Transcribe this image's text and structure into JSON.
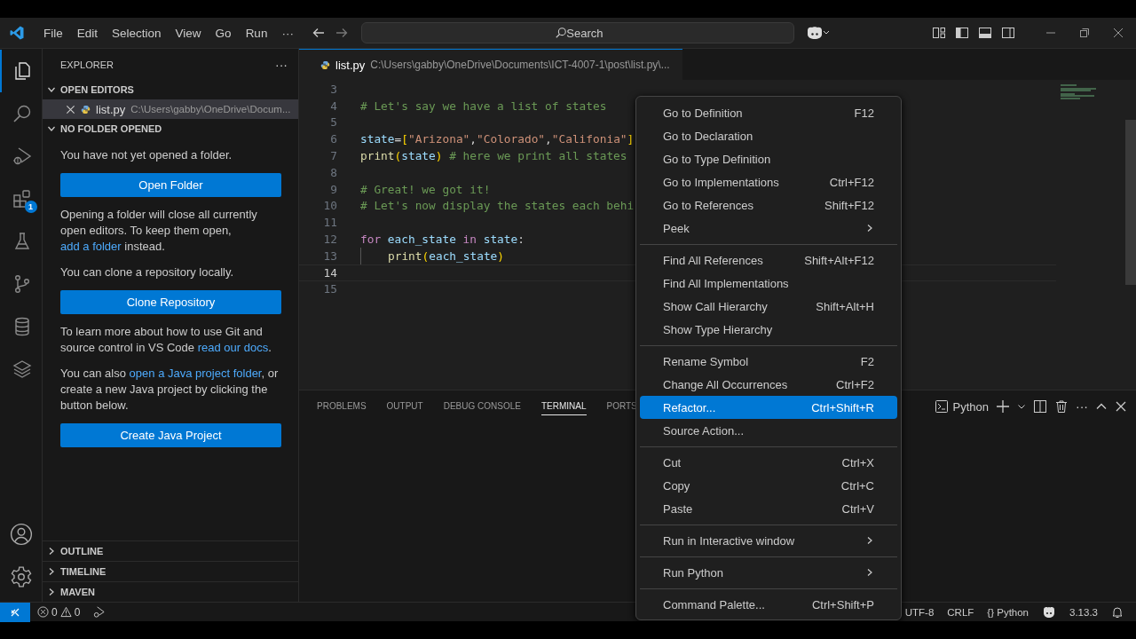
{
  "title_bar": {
    "menu": [
      "File",
      "Edit",
      "Selection",
      "View",
      "Go",
      "Run",
      "···"
    ],
    "search": {
      "placeholder": "Search"
    }
  },
  "activity_bar": {
    "items": [
      {
        "kind": "explorer",
        "selected": true
      },
      {
        "kind": "search",
        "selected": false
      },
      {
        "kind": "debug",
        "selected": false
      },
      {
        "kind": "extensions",
        "selected": false,
        "badge": "1"
      },
      {
        "kind": "testing",
        "selected": false
      },
      {
        "kind": "source-control",
        "selected": false
      },
      {
        "kind": "database",
        "selected": false
      },
      {
        "kind": "layers",
        "selected": false
      }
    ],
    "bottom": [
      {
        "kind": "account"
      },
      {
        "kind": "settings"
      }
    ]
  },
  "sidebar": {
    "title": "EXPLORER",
    "more": "···",
    "open_editors": {
      "title": "OPEN EDITORS",
      "expanded": true,
      "items": [
        {
          "name": "list.py",
          "path": "C:\\Users\\gabby\\OneDrive\\Docum...",
          "selected": true
        }
      ]
    },
    "folder": {
      "title": "NO FOLDER OPENED",
      "expanded": true,
      "blocks": [
        {
          "kind": "text",
          "parts": [
            {
              "text": "You have not yet opened a folder."
            }
          ]
        },
        {
          "kind": "button",
          "text": "Open Folder"
        },
        {
          "kind": "text",
          "parts": [
            {
              "text": "Opening a folder will close all currently open editors. To keep them open, "
            },
            {
              "text": "add a folder",
              "link": true
            },
            {
              "text": " instead."
            }
          ]
        },
        {
          "kind": "text",
          "parts": [
            {
              "text": "You can clone a repository locally."
            }
          ]
        },
        {
          "kind": "button",
          "text": "Clone Repository"
        },
        {
          "kind": "text",
          "parts": [
            {
              "text": "To learn more about how to use Git and source control in VS Code "
            },
            {
              "text": "read our docs",
              "link": true
            },
            {
              "text": "."
            }
          ]
        },
        {
          "kind": "text",
          "parts": [
            {
              "text": "You can also "
            },
            {
              "text": "open a Java project folder",
              "link": true
            },
            {
              "text": ", or create a new Java project by clicking the button below."
            }
          ]
        },
        {
          "kind": "button",
          "text": "Create Java Project"
        }
      ]
    },
    "sections": [
      {
        "title": "OUTLINE",
        "expanded": false
      },
      {
        "title": "TIMELINE",
        "expanded": false
      },
      {
        "title": "MAVEN",
        "expanded": false
      }
    ]
  },
  "editor": {
    "tab": {
      "name": "list.py",
      "path": "C:\\Users\\gabby\\OneDrive\\Documents\\ICT-4007-1\\post\\list.py\\..."
    },
    "lines": [
      {
        "number": "3",
        "current": false,
        "indent": false
      },
      {
        "number": "4",
        "current": false,
        "indent": false,
        "tokens": [
          {
            "text": "# Let's say we have a list of states",
            "kind": "comment"
          }
        ]
      },
      {
        "number": "5",
        "current": false,
        "indent": false
      },
      {
        "number": "6",
        "current": false,
        "indent": false,
        "tokens": [
          {
            "text": "state",
            "kind": "variable"
          },
          {
            "text": "=",
            "kind": "operator"
          },
          {
            "text": "[",
            "kind": "bracket"
          },
          {
            "text": "\"Arizona\"",
            "kind": "string"
          },
          {
            "text": ",",
            "kind": "operator"
          },
          {
            "text": "\"Colorado\"",
            "kind": "string"
          },
          {
            "text": ",",
            "kind": "operator"
          },
          {
            "text": "\"Califonia\"",
            "kind": "string"
          },
          {
            "text": "]",
            "kind": "bracket"
          }
        ]
      },
      {
        "number": "7",
        "current": false,
        "indent": false,
        "tokens": [
          {
            "text": "print",
            "kind": "function"
          },
          {
            "text": "(",
            "kind": "bracket"
          },
          {
            "text": "state",
            "kind": "variable"
          },
          {
            "text": ")",
            "kind": "bracket"
          },
          {
            "text": " # here we print all states",
            "kind": "comment"
          }
        ]
      },
      {
        "number": "8",
        "current": false,
        "indent": false
      },
      {
        "number": "9",
        "current": false,
        "indent": false,
        "tokens": [
          {
            "text": "# Great! we got it!",
            "kind": "comment"
          }
        ]
      },
      {
        "number": "10",
        "current": false,
        "indent": false,
        "tokens": [
          {
            "text": "# Let's now display the states each behi",
            "kind": "comment"
          }
        ]
      },
      {
        "number": "11",
        "current": false,
        "indent": false
      },
      {
        "number": "12",
        "current": false,
        "indent": false,
        "tokens": [
          {
            "text": "for",
            "kind": "keyword"
          },
          {
            "text": " each_state",
            "kind": "variable"
          },
          {
            "text": " in",
            "kind": "keyword"
          },
          {
            "text": " state",
            "kind": "variable"
          },
          {
            "text": ":",
            "kind": "operator"
          }
        ]
      },
      {
        "number": "13",
        "current": false,
        "indent": true,
        "tokens": [
          {
            "text": "print",
            "kind": "function"
          },
          {
            "text": "(",
            "kind": "bracket"
          },
          {
            "text": "each_state",
            "kind": "variable"
          },
          {
            "text": ")",
            "kind": "bracket"
          }
        ]
      },
      {
        "number": "14",
        "current": true,
        "indent": false
      },
      {
        "number": "15",
        "current": false,
        "indent": false
      }
    ]
  },
  "panel": {
    "tabs": [
      {
        "label": "PROBLEMS",
        "selected": false
      },
      {
        "label": "OUTPUT",
        "selected": false
      },
      {
        "label": "DEBUG CONSOLE",
        "selected": false
      },
      {
        "label": "TERMINAL",
        "selected": true
      },
      {
        "label": "PORTS",
        "selected": false
      }
    ],
    "terminal": "Python",
    "more": "···"
  },
  "context_menu": {
    "groups": [
      [
        {
          "label": "Go to Definition",
          "shortcut": "F12",
          "submenu": false,
          "selected": false
        },
        {
          "label": "Go to Declaration",
          "submenu": false,
          "selected": false
        },
        {
          "label": "Go to Type Definition",
          "submenu": false,
          "selected": false
        },
        {
          "label": "Go to Implementations",
          "shortcut": "Ctrl+F12",
          "submenu": false,
          "selected": false
        },
        {
          "label": "Go to References",
          "shortcut": "Shift+F12",
          "submenu": false,
          "selected": false
        },
        {
          "label": "Peek",
          "submenu": true,
          "selected": false
        }
      ],
      [
        {
          "label": "Find All References",
          "shortcut": "Shift+Alt+F12",
          "submenu": false,
          "selected": false
        },
        {
          "label": "Find All Implementations",
          "submenu": false,
          "selected": false
        },
        {
          "label": "Show Call Hierarchy",
          "shortcut": "Shift+Alt+H",
          "submenu": false,
          "selected": false
        },
        {
          "label": "Show Type Hierarchy",
          "submenu": false,
          "selected": false
        }
      ],
      [
        {
          "label": "Rename Symbol",
          "shortcut": "F2",
          "submenu": false,
          "selected": false
        },
        {
          "label": "Change All Occurrences",
          "shortcut": "Ctrl+F2",
          "submenu": false,
          "selected": false
        },
        {
          "label": "Refactor...",
          "shortcut": "Ctrl+Shift+R",
          "submenu": false,
          "selected": true
        },
        {
          "label": "Source Action...",
          "submenu": false,
          "selected": false
        }
      ],
      [
        {
          "label": "Cut",
          "shortcut": "Ctrl+X",
          "submenu": false,
          "selected": false
        },
        {
          "label": "Copy",
          "shortcut": "Ctrl+C",
          "submenu": false,
          "selected": false
        },
        {
          "label": "Paste",
          "shortcut": "Ctrl+V",
          "submenu": false,
          "selected": false
        }
      ],
      [
        {
          "label": "Run in Interactive window",
          "submenu": true,
          "selected": false
        }
      ],
      [
        {
          "label": "Run Python",
          "submenu": true,
          "selected": false
        }
      ],
      [
        {
          "label": "Command Palette...",
          "shortcut": "Ctrl+Shift+P",
          "submenu": false,
          "selected": false
        }
      ]
    ]
  },
  "status_bar": {
    "errors": "0",
    "warnings": "0",
    "right": [
      {
        "kind": "text",
        "text": "UTF-8"
      },
      {
        "kind": "text",
        "text": "CRLF"
      },
      {
        "kind": "language",
        "icon": "{}",
        "text": "Python"
      },
      {
        "kind": "copilot"
      },
      {
        "kind": "text",
        "text": "3.13.3"
      },
      {
        "kind": "bell"
      }
    ]
  }
}
